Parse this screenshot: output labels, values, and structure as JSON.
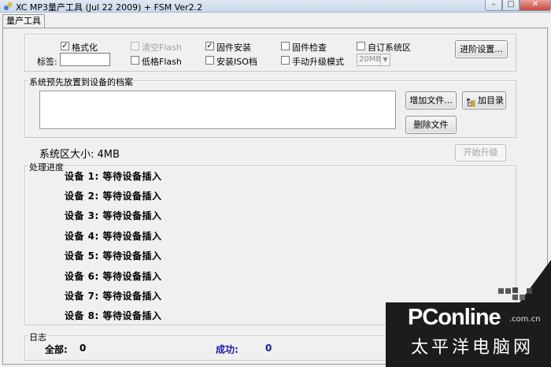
{
  "window": {
    "title": "XC MP3量产工具 (Jul 22 2009) + FSM Ver2.2"
  },
  "tab": {
    "label": "量产工具"
  },
  "options": {
    "format": {
      "label": "格式化",
      "checked": true
    },
    "clear_flash": {
      "label": "清空Flash",
      "checked": false
    },
    "firmware_install": {
      "label": "固件安装",
      "checked": true
    },
    "firmware_check": {
      "label": "固件检查",
      "checked": false
    },
    "custom_sys_area": {
      "label": "自订系统区",
      "checked": false
    },
    "lowgrade_flash": {
      "label": "低格Flash",
      "checked": false
    },
    "install_iso": {
      "label": "安装ISO档",
      "checked": false
    },
    "manual_upgrade": {
      "label": "手动升级模式",
      "checked": false
    },
    "tag_label": "标签:",
    "tag_value": "",
    "size_select": "20MB",
    "advanced_button": "进阶设置..."
  },
  "preload": {
    "legend": "系统预先放置到设备的档案",
    "add_file_button": "增加文件...",
    "add_dir_button": "加目录",
    "delete_file_button": "删除文件"
  },
  "system_area": {
    "size_text": "系统区大小: 4MB"
  },
  "start_button": "开始升级",
  "progress": {
    "legend": "处理进度",
    "devices": [
      "设备 1:  等待设备插入",
      "设备 2:  等待设备插入",
      "设备 3:  等待设备插入",
      "设备 4:  等待设备插入",
      "设备 5:  等待设备插入",
      "设备 6:  等待设备插入",
      "设备 7:  等待设备插入",
      "设备 8:  等待设备插入"
    ]
  },
  "log": {
    "legend": "日志",
    "total_label": "全部:",
    "total_value": "0",
    "success_label": "成功:",
    "success_value": "0"
  },
  "watermark": {
    "brand": "PConline",
    "domain": ".com.cn",
    "subtitle": "太平洋电脑网"
  },
  "colors": {
    "success": "#1a1aa8",
    "watermark_bg": "#1c1c1c",
    "title_bg": "#d4e0ee"
  }
}
